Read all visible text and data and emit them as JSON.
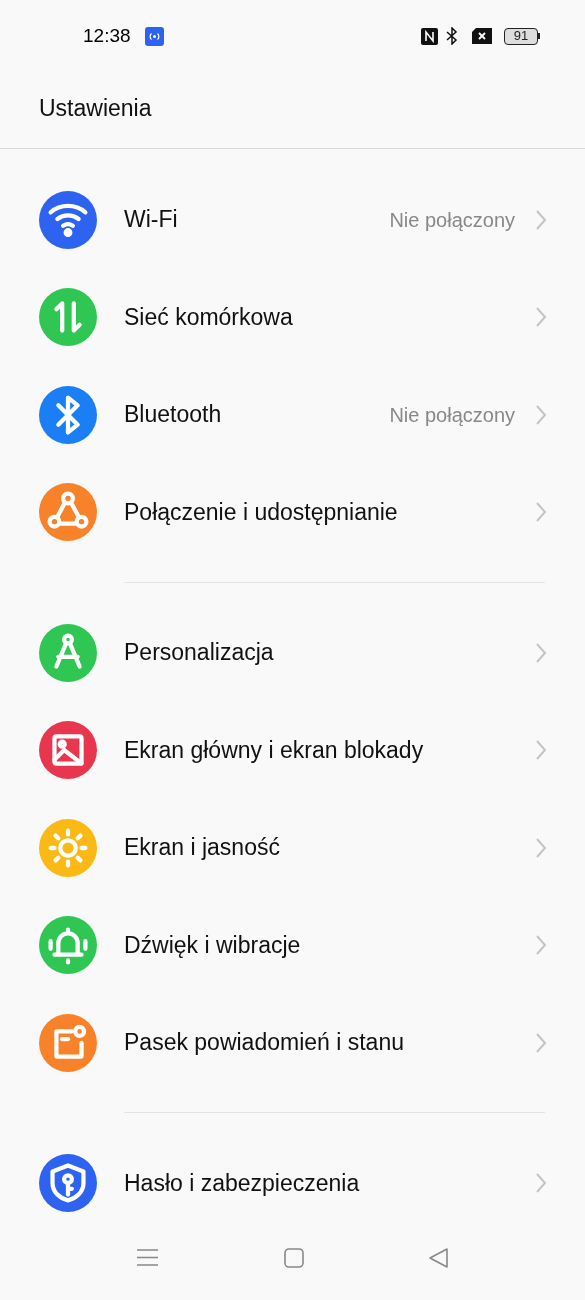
{
  "status_bar": {
    "time": "12:38",
    "battery": "91"
  },
  "window": {
    "title": "Ustawienia"
  },
  "groups": [
    {
      "items": [
        {
          "label": "Wi-Fi",
          "value": "Nie połączony",
          "kind": "wifi",
          "color": "#2d63f0"
        },
        {
          "label": "Sieć komórkowa",
          "kind": "cellular",
          "color": "#2fc653"
        },
        {
          "label": "Bluetooth",
          "value": "Nie połączony",
          "kind": "bluetooth",
          "color": "#1a7ef5"
        },
        {
          "label": "Połączenie i udostępnianie",
          "kind": "share",
          "color": "#f7822a"
        }
      ]
    },
    {
      "items": [
        {
          "label": "Personalizacja",
          "kind": "compass",
          "color": "#2fc653"
        },
        {
          "label": "Ekran główny i ekran blokady",
          "kind": "image",
          "color": "#e8364f"
        },
        {
          "label": "Ekran i jasność",
          "kind": "sun",
          "color": "#fbb915"
        },
        {
          "label": "Dźwięk i wibracje",
          "kind": "bell",
          "color": "#2fc653"
        },
        {
          "label": "Pasek powiadomień i stanu",
          "kind": "notification",
          "color": "#f7822a"
        }
      ]
    },
    {
      "items": [
        {
          "label": "Hasło i zabezpieczenia",
          "kind": "shield",
          "color": "#2d63f0"
        }
      ]
    }
  ]
}
